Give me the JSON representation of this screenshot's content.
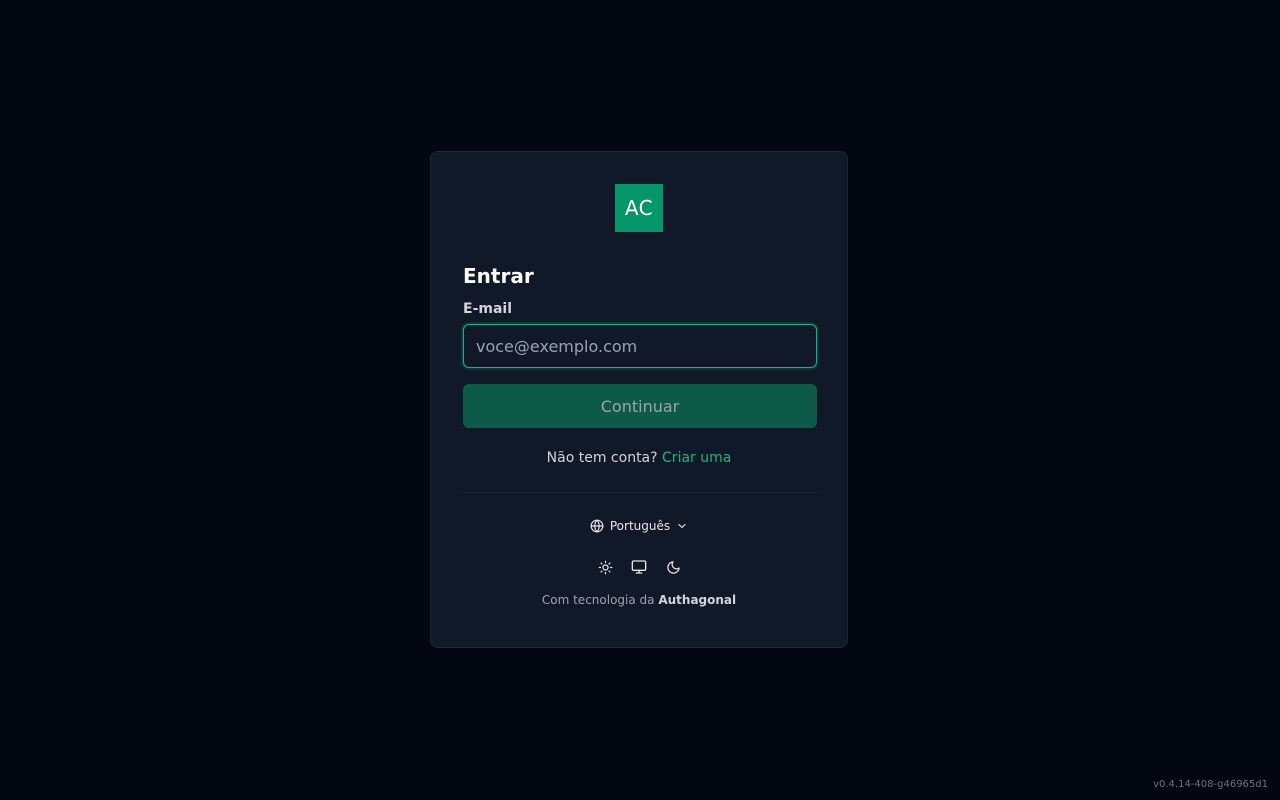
{
  "logo": {
    "text": "AC",
    "color": "#059669"
  },
  "form": {
    "title": "Entrar",
    "email_label": "E-mail",
    "email_placeholder": "voce@exemplo.com",
    "email_value": "",
    "continue_label": "Continuar",
    "signup_prompt": "Não tem conta?",
    "signup_link": "Criar uma"
  },
  "language": {
    "selected": "Português",
    "icon": "globe-icon"
  },
  "theme": {
    "options": [
      {
        "name": "light",
        "icon": "sun-icon"
      },
      {
        "name": "system",
        "icon": "monitor-icon"
      },
      {
        "name": "dark",
        "icon": "moon-icon"
      }
    ]
  },
  "footer": {
    "powered_prefix": "Com tecnologia da",
    "powered_brand": "Authagonal"
  },
  "version": "v0.4.14-408-g46965d1",
  "colors": {
    "background": "#030712",
    "card": "#111827",
    "accent": "#10b981",
    "button": "#0d5a48"
  }
}
